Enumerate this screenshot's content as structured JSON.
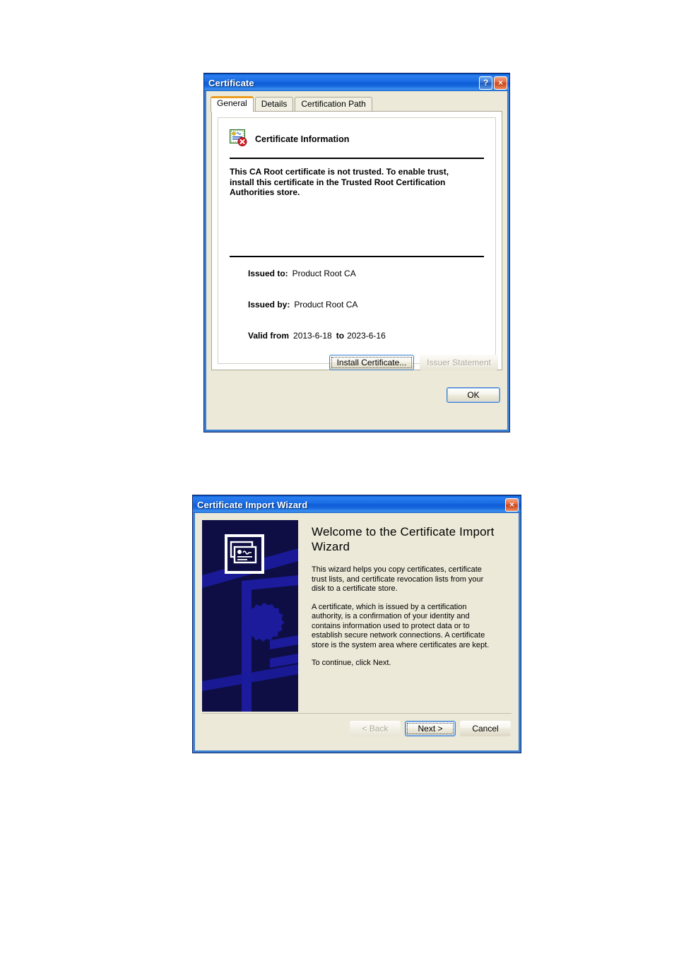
{
  "page": {
    "background": "#ffffff"
  },
  "certificate_dialog": {
    "title": "Certificate",
    "help_button": "?",
    "close_button": "×",
    "tabs": [
      {
        "label": "General",
        "active": true
      },
      {
        "label": "Details",
        "active": false
      },
      {
        "label": "Certification Path",
        "active": false
      }
    ],
    "panel": {
      "icon_name": "certificate-invalid-icon",
      "heading": "Certificate Information",
      "warning": "This CA Root certificate is not trusted. To enable trust, install this certificate in the Trusted Root Certification Authorities store.",
      "fields": {
        "issued_to_label": "Issued to:",
        "issued_to_value": "Product Root CA",
        "issued_by_label": "Issued by:",
        "issued_by_value": "Product Root CA",
        "valid_from_label": "Valid from",
        "valid_from_value": "2013-6-18",
        "valid_to_label": "to",
        "valid_to_value": "2023-6-16"
      }
    },
    "buttons": {
      "install_certificate": "Install Certificate...",
      "issuer_statement": "Issuer Statement",
      "ok": "OK"
    }
  },
  "wizard_dialog": {
    "title": "Certificate Import Wizard",
    "close_button": "×",
    "watermark_name": "certificate-wizard-watermark",
    "heading": "Welcome to the Certificate Import Wizard",
    "paragraphs": [
      "This wizard helps you copy certificates, certificate trust lists, and certificate revocation lists from your disk to a certificate store.",
      "A certificate, which is issued by a certification authority, is a confirmation of your identity and contains information used to protect data or to establish secure network connections. A certificate store is the system area where certificates are kept.",
      "To continue, click Next."
    ],
    "buttons": {
      "back": "< Back",
      "next": "Next >",
      "cancel": "Cancel"
    }
  },
  "colors": {
    "titlebar_blue": "#1c6fe4",
    "dialog_face": "#ece9d8",
    "active_tab_accent": "#ec9d1f",
    "watermark_navy": "#0a0a3c",
    "watermark_blue": "#1a1a9e",
    "close_red": "#cf4215",
    "disabled_text": "#aca899"
  }
}
